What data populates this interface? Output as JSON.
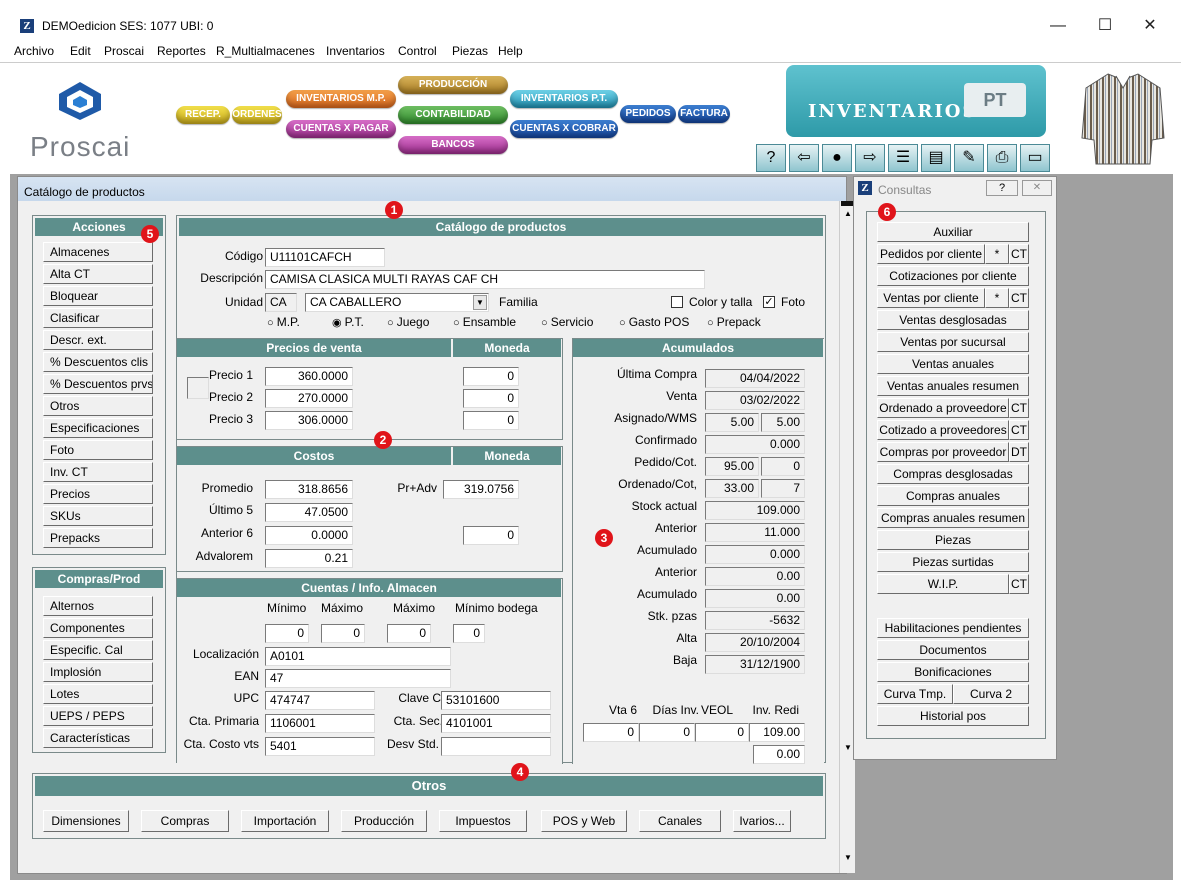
{
  "window": {
    "icon": "Z",
    "title": "DEMOedicion  SES: 1077  UBI: 0",
    "minimize": "—",
    "maximize": "☐",
    "close": "✕"
  },
  "menu": [
    "Archivo",
    "Edit",
    "Proscai",
    "Reportes",
    "R_Multialmacenes",
    "Inventarios",
    "Control",
    "Piezas",
    "Help"
  ],
  "brand": {
    "logo_text": "Proscai"
  },
  "modules": {
    "recep": "RECEP.",
    "ordenes": "ORDENES",
    "inventarios_mp": "INVENTARIOS M.P.",
    "cuentas_pagar": "CUENTAS X PAGAR",
    "produccion": "PRODUCCIÓN",
    "contabilidad": "CONTABILIDAD",
    "bancos": "BANCOS",
    "inventarios_pt": "INVENTARIOS P.T.",
    "cuentas_cobrar": "CUENTAS X COBRAR",
    "pedidos": "PEDIDOS",
    "factura": "FACTURA"
  },
  "banner": {
    "title": "Inventarios",
    "tag": "PT"
  },
  "toolbar_icons": [
    "help-icon",
    "back-arrow-icon",
    "search-icon",
    "forward-arrow-icon",
    "list-icon",
    "copy-icon",
    "edit-icon",
    "print-icon",
    "window-icon"
  ],
  "toolbar_glyphs": [
    "?",
    "⇦",
    "●",
    "⇨",
    "☰",
    "▤",
    "✎",
    "⎙",
    "▭"
  ],
  "catalog": {
    "window_title": "Catálogo de productos",
    "header": "Catálogo de productos",
    "codigo_label": "Código",
    "codigo": "U11101CAFCH",
    "descripcion_label": "Descripción",
    "descripcion": "CAMISA CLASICA MULTI RAYAS CAF CH",
    "unidad_label": "Unidad",
    "unidad_code": "CA",
    "unidad_value": "CA  CABALLERO",
    "familia_label": "Familia",
    "color_talla_label": "Color y talla",
    "color_talla_checked": false,
    "foto_label": "Foto",
    "foto_checked": true,
    "tipos": [
      "M.P.",
      "P.T.",
      "Juego",
      "Ensamble",
      "Servicio",
      "Gasto POS",
      "Prepack"
    ],
    "tipo_selected": "P.T."
  },
  "acciones": {
    "header": "Acciones",
    "items": [
      "Almacenes",
      "Alta CT",
      "Bloquear",
      "Clasificar",
      "Descr. ext.",
      "% Descuentos clis",
      "% Descuentos prvs",
      "Otros",
      "Especificaciones",
      "Foto",
      "Inv. CT",
      "Precios",
      "SKUs",
      "Prepacks"
    ]
  },
  "compras": {
    "header": "Compras/Prod",
    "items": [
      "Alternos",
      "Componentes",
      "Especific. Cal",
      "Implosión",
      "Lotes",
      "UEPS / PEPS",
      "Características"
    ]
  },
  "precios": {
    "header": "Precios de venta",
    "moneda_header": "Moneda",
    "rows": [
      {
        "label": "Precio 1",
        "value": "360.0000",
        "moneda": "0"
      },
      {
        "label": "Precio 2",
        "value": "270.0000",
        "moneda": "0"
      },
      {
        "label": "Precio 3",
        "value": "306.0000",
        "moneda": "0"
      }
    ]
  },
  "costos": {
    "header": "Costos",
    "moneda_header": "Moneda",
    "promedio_label": "Promedio",
    "promedio": "318.8656",
    "pradv_label": "Pr+Adv",
    "pradv": "319.0756",
    "ultimo5_label": "Último 5",
    "ultimo5": "47.0500",
    "anterior6_label": "Anterior 6",
    "anterior6": "0.0000",
    "anterior6_moneda": "0",
    "advalorem_label": "Advalorem",
    "advalorem": "0.21"
  },
  "cuentas": {
    "header": "Cuentas / Info. Almacen",
    "minimo_label": "Mínimo",
    "maximo_label": "Máximo",
    "maximo2_label": "Máximo",
    "minimo_bodega_label": "Mínimo bodega",
    "minimo": "0",
    "maximo": "0",
    "maximo2": "0",
    "minimo_bodega": "0",
    "localizacion_label": "Localización",
    "localizacion": "A0101",
    "ean_label": "EAN",
    "ean": "47",
    "upc_label": "UPC",
    "upc": "474747",
    "clave_cfd_label": "Clave CFD",
    "clave_cfd": "53101600",
    "cta_primaria_label": "Cta. Primaria",
    "cta_primaria": "1106001",
    "cta_sec_label": "Cta. Sec.",
    "cta_sec": "4101001",
    "cta_costo_label": "Cta. Costo vts",
    "cta_costo": "5401",
    "desv_label": "Desv Std.",
    "desv": ""
  },
  "acumulados": {
    "header": "Acumulados",
    "ultima_compra_label": "Última Compra",
    "ultima_compra": "04/04/2022",
    "venta_label": "Venta",
    "venta": "03/02/2022",
    "asignado_label": "Asignado/WMS",
    "asignado_a": "5.00",
    "asignado_b": "5.00",
    "confirmado_label": "Confirmado",
    "confirmado": "0.000",
    "pedido_label": "Pedido/Cot.",
    "pedido_a": "95.00",
    "pedido_b": "0",
    "ordenado_label": "Ordenado/Cot,",
    "ordenado_a": "33.00",
    "ordenado_b": "7",
    "stock_label": "Stock actual",
    "stock": "109.000",
    "anterior1_label": "Anterior",
    "anterior1": "11.000",
    "acumulado1_label": "Acumulado",
    "acumulado1": "0.000",
    "anterior2_label": "Anterior",
    "anterior2": "0.00",
    "acumulado2_label": "Acumulado",
    "acumulado2": "0.00",
    "stk_pzas_label": "Stk. pzas",
    "stk_pzas": "-5632",
    "alta_label": "Alta",
    "alta": "20/10/2004",
    "baja_label": "Baja",
    "baja": "31/12/1900",
    "vta6_label": "Vta 6",
    "dias_inv_label": "Días Inv.",
    "veol_label": "VEOL",
    "inv_redi_label": "Inv. Redi",
    "vta6": "0",
    "dias_inv": "0",
    "veol": "0",
    "inv_redi": "109.00",
    "extra": "0.00"
  },
  "otros": {
    "header": "Otros",
    "buttons": [
      "Dimensiones",
      "Compras",
      "Importación",
      "Producción",
      "Impuestos",
      "POS y Web",
      "Canales",
      "Ivarios..."
    ]
  },
  "consultas": {
    "title": "Consultas",
    "help": "?",
    "close": "✕",
    "items": [
      "Auxiliar",
      "Pedidos por cliente",
      "Cotizaciones por cliente",
      "Ventas por cliente",
      "Ventas desglosadas",
      "Ventas por sucursal",
      "Ventas anuales",
      "Ventas anuales resumen",
      "Ordenado a proveedore",
      "Cotizado a proveedores",
      "Compras por proveedor",
      "Compras desglosadas",
      "Compras anuales",
      "Compras anuales resumen",
      "Piezas",
      "Piezas surtidas",
      "W.I.P."
    ],
    "star": "*",
    "ct": "CT",
    "dt": "DT",
    "bottom": [
      "Habilitaciones pendientes",
      "Documentos",
      "Bonificaciones",
      "Curva Tmp.",
      "Curva 2",
      "Historial pos"
    ]
  },
  "badges": [
    "1",
    "2",
    "3",
    "4",
    "5",
    "6"
  ]
}
